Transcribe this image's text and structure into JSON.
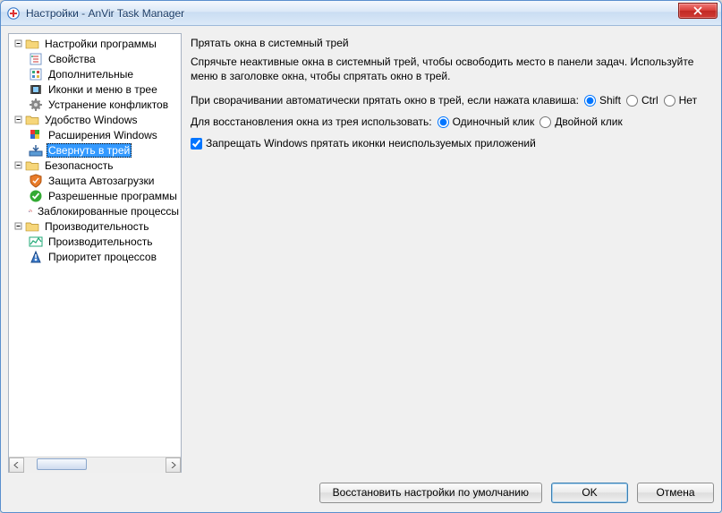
{
  "window": {
    "title": "Настройки - AnVir Task Manager"
  },
  "tree": {
    "groups": [
      {
        "label": "Настройки программы",
        "children": [
          {
            "label": "Свойства",
            "icon": "properties"
          },
          {
            "label": "Дополнительные",
            "icon": "additional"
          },
          {
            "label": "Иконки и меню в трее",
            "icon": "film"
          },
          {
            "label": "Устранение конфликтов",
            "icon": "gear"
          }
        ]
      },
      {
        "label": "Удобство Windows",
        "children": [
          {
            "label": "Расширения Windows",
            "icon": "flag"
          },
          {
            "label": "Свернуть в трей",
            "icon": "tray",
            "selected": true
          }
        ]
      },
      {
        "label": "Безопасность",
        "children": [
          {
            "label": "Защита Автозагрузки",
            "icon": "shield"
          },
          {
            "label": "Разрешенные программы",
            "icon": "allow"
          },
          {
            "label": "Заблокированные процессы",
            "icon": "block"
          }
        ]
      },
      {
        "label": "Производительность",
        "children": [
          {
            "label": "Производительность",
            "icon": "perf"
          },
          {
            "label": "Приоритет процессов",
            "icon": "priority"
          }
        ]
      }
    ]
  },
  "panel": {
    "title": "Прятать окна в системный трей",
    "description": "Спрячьте неактивные окна в системный трей, чтобы освободить место в панели задач. Используйте меню в заголовке окна, чтобы спрятать окно в трей.",
    "row1_label": "При сворачивании автоматически прятать окно в трей, если нажата клавиша:",
    "opt_shift": "Shift",
    "opt_ctrl": "Ctrl",
    "opt_none": "Нет",
    "row2_label": "Для восстановления окна из трея использовать:",
    "opt_single": "Одиночный клик",
    "opt_double": "Двойной клик",
    "checkbox_label": "Запрещать Windows прятать иконки неиспользуемых приложений",
    "row1_selected": "shift",
    "row2_selected": "single",
    "checkbox_checked": true
  },
  "buttons": {
    "restore_defaults": "Восстановить настройки по умолчанию",
    "ok": "OK",
    "cancel": "Отмена"
  }
}
